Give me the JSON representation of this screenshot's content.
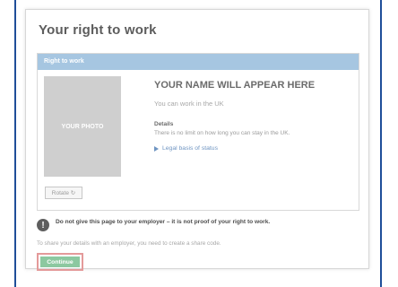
{
  "page": {
    "title": "Your right to work"
  },
  "card": {
    "header": "Right to work",
    "photo_label": "YOUR PHOTO",
    "rotate_label": "Rotate ↻",
    "name": "YOUR NAME WILL APPEAR HERE",
    "status": "You can work in the UK",
    "details_label": "Details",
    "details_text": "There is no limit on how long you can stay in the UK.",
    "legal_link": "Legal basis of status"
  },
  "warning": {
    "text": "Do not give this page to your employer – it is not proof of your right to work."
  },
  "share": {
    "text": "To share your details with an employer, you need to create a share code."
  },
  "actions": {
    "continue_label": "Continue"
  },
  "colors": {
    "frame": "#1f4e99",
    "header": "#a6c6e1",
    "continue": "#8cc8a0",
    "continue_outline": "#e49a9a",
    "link": "#6f95c2"
  }
}
